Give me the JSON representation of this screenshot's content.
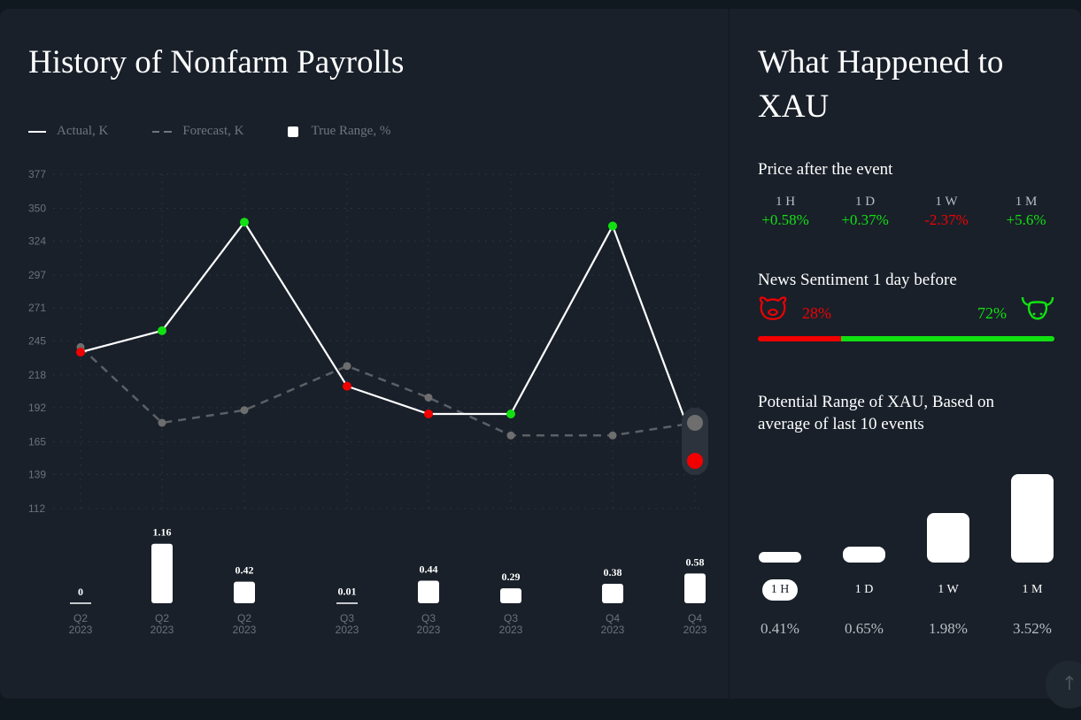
{
  "left_panel": {
    "title": "History of Nonfarm Payrolls",
    "legend": {
      "actual": "Actual, K",
      "forecast": "Forecast, K",
      "range": "True Range, %"
    }
  },
  "chart_data": {
    "type": "line",
    "y_ticks": [
      377,
      350,
      324,
      297,
      271,
      245,
      218,
      192,
      165,
      139,
      112
    ],
    "ylim": [
      112,
      377
    ],
    "grid": true,
    "x_quarters": [
      "Q2",
      "Q2",
      "Q2",
      "Q3",
      "Q3",
      "Q3",
      "Q4",
      "Q4"
    ],
    "x_years": [
      "2023",
      "2023",
      "2023",
      "2023",
      "2023",
      "2023",
      "2023",
      "2023"
    ],
    "series": [
      {
        "name": "Actual, K",
        "values": [
          236,
          253,
          339,
          209,
          187,
          187,
          336,
          null
        ]
      },
      {
        "name": "Forecast, K",
        "values": [
          240,
          180,
          190,
          225,
          200,
          170,
          170,
          180
        ]
      }
    ],
    "true_range_pct": {
      "name": "True Range, %",
      "values": [
        0,
        1.16,
        0.42,
        0.01,
        0.44,
        0.29,
        0.38,
        0.58
      ],
      "labels": [
        "0",
        "1.16",
        "0.42",
        "0.01",
        "0.44",
        "0.29",
        "0.38",
        "0.58"
      ]
    },
    "colors": {
      "up": "#11e011",
      "down": "#f20000",
      "pending": "#6e6e6e",
      "actual_line": "#ffffff",
      "forecast_line": "#5c6066"
    }
  },
  "right_panel": {
    "title_line1": "What Happened to",
    "title_line2": "XAU",
    "price_after": {
      "label": "Price after the event",
      "items": [
        {
          "period": "1 H",
          "value": "+0.58%",
          "color": "#11e011"
        },
        {
          "period": "1 D",
          "value": "+0.37%",
          "color": "#11e011"
        },
        {
          "period": "1 W",
          "value": "-2.37%",
          "color": "#f20000"
        },
        {
          "period": "1 M",
          "value": "+5.6%",
          "color": "#11e011"
        }
      ]
    },
    "sentiment": {
      "label": "News Sentiment 1 day before",
      "bear_pct": "28%",
      "bull_pct": "72%",
      "bear_fraction": 0.28,
      "bear_color": "#f20000",
      "bull_color": "#11e011"
    },
    "potential_range": {
      "label_line1": "Potential Range of XAU, Based on",
      "label_line2": "average of last 10 events",
      "items": [
        {
          "period": "1 H",
          "value": "0.41%",
          "pct": 0.41,
          "active": true
        },
        {
          "period": "1 D",
          "value": "0.65%",
          "pct": 0.65,
          "active": false
        },
        {
          "period": "1 W",
          "value": "1.98%",
          "pct": 1.98,
          "active": false
        },
        {
          "period": "1 M",
          "value": "3.52%",
          "pct": 3.52,
          "active": false
        }
      ]
    }
  }
}
